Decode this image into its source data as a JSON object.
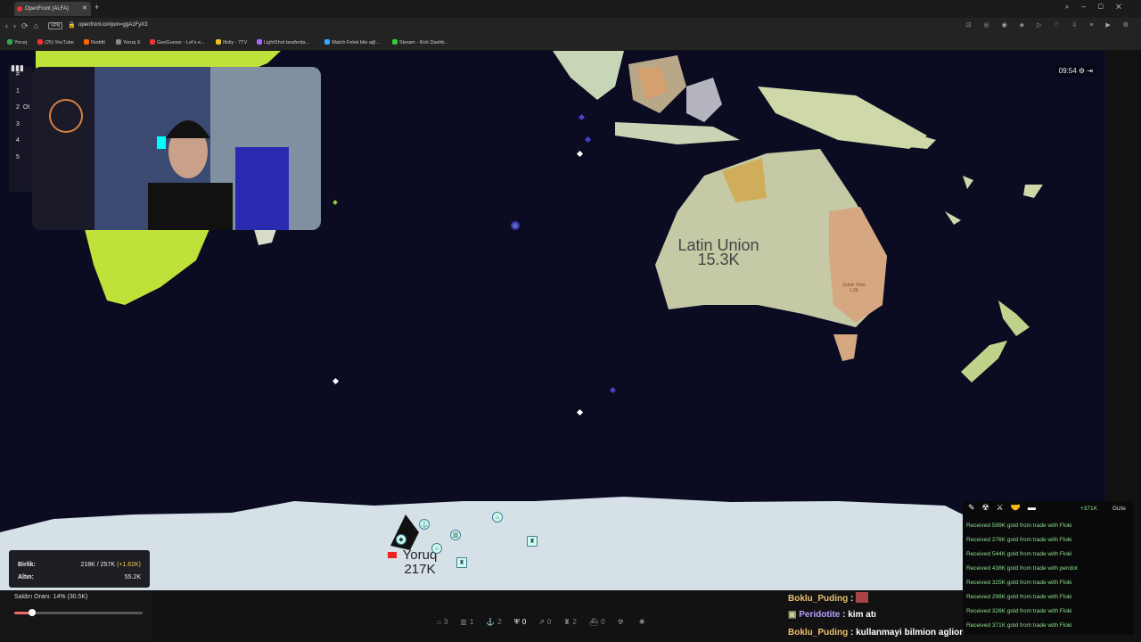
{
  "browser": {
    "tab_title": "OpenFront (ALFA)",
    "url": "openfront.io/#join=ggA1FyX3",
    "vpn_label": "VPN",
    "bookmarks": [
      {
        "label": "Yoruq",
        "color": "#2aa84a"
      },
      {
        "label": "(25) YouTube",
        "color": "#e33"
      },
      {
        "label": "Reddit",
        "color": "#f60"
      },
      {
        "label": "Yoruq X",
        "color": "#888"
      },
      {
        "label": "GeoGuessr - Let's e...",
        "color": "#e33"
      },
      {
        "label": "Ifisliy - 7TV",
        "color": "#f0c020"
      },
      {
        "label": "LightShot tarafında...",
        "color": "#a6f"
      },
      {
        "label": "Watch Felek bile aĝl...",
        "color": "#3af"
      },
      {
        "label": "Stream - Kick Dashb...",
        "color": "#3c3"
      }
    ]
  },
  "game": {
    "timer": "09:54",
    "leaderboard": [
      "#",
      "1",
      "2",
      "3",
      "4",
      "5"
    ],
    "leaderboard_partial": "Ot",
    "regions": {
      "latin_union": {
        "name": "Latin Union",
        "value": "15.3K"
      },
      "small_tribe": {
        "name": "Gubik Tribe",
        "value": "1.3K"
      },
      "player": {
        "name": "Yoruq",
        "value": "217K"
      }
    },
    "stats": {
      "troops_label": "Birlik:",
      "troops_value": "218K / 257K",
      "troops_delta": "(+1.62K)",
      "gold_label": "Altın:",
      "gold_value": "55.2K"
    },
    "attack": {
      "label": "Saldırı Oranı: 14% (30.5K)",
      "ratio": 0.14
    },
    "toolbar": [
      {
        "icon": "city-icon",
        "count": "3"
      },
      {
        "icon": "factory-icon",
        "count": "1"
      },
      {
        "icon": "port-icon",
        "count": "2"
      },
      {
        "icon": "defense-icon",
        "count": "0"
      },
      {
        "icon": "missile-silo-icon",
        "count": "0"
      },
      {
        "icon": "sam-icon",
        "count": "2"
      },
      {
        "icon": "warship-icon",
        "count": "0"
      },
      {
        "icon": "nuke-icon",
        "count": ""
      },
      {
        "icon": "mirv-icon",
        "count": ""
      }
    ],
    "events_header": {
      "gold_total": "+371K",
      "hide_label": "Gizle"
    },
    "events": [
      "Received 599K gold from trade with Floki",
      "Received 276K gold from trade with Floki",
      "Received 544K gold from trade with Floki",
      "Received 438K gold from trade with peridot",
      "Received 325K gold from trade with Floki",
      "Received 298K gold from trade with Floki",
      "Received 326K gold from trade with Floki",
      "Received 371K gold from trade with Floki"
    ]
  },
  "chat": [
    {
      "user": "Boklu_Puding",
      "sep": " : ",
      "message": "",
      "emote": true,
      "color": "n1"
    },
    {
      "user": "Peridotite",
      "sep": " : ",
      "message": "kim atı",
      "color": "n2"
    },
    {
      "user": "Boklu_Puding",
      "sep": " : ",
      "message": "kullanmayi bilmion aglion",
      "color": "n1"
    }
  ]
}
